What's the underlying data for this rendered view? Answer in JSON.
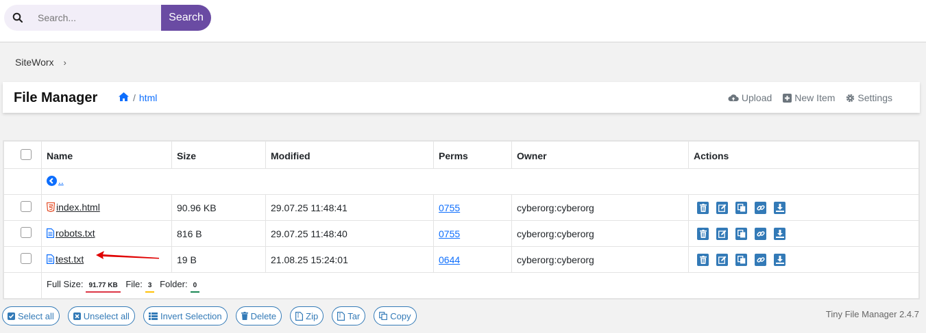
{
  "search": {
    "placeholder": "Search...",
    "button_label": "Search"
  },
  "breadcrumb": {
    "label": "SiteWorx"
  },
  "header": {
    "title": "File Manager",
    "path": "html",
    "actions": {
      "upload": "Upload",
      "new_item": "New Item",
      "settings": "Settings"
    }
  },
  "table": {
    "columns": [
      "Name",
      "Size",
      "Modified",
      "Perms",
      "Owner",
      "Actions"
    ],
    "parent_link": "..",
    "rows": [
      {
        "name": "index.html",
        "size": "90.96 KB",
        "modified": "29.07.25 11:48:41",
        "perms": "0755",
        "owner": "cyberorg:cyberorg",
        "icon": "html5-icon"
      },
      {
        "name": "robots.txt",
        "size": "816 B",
        "modified": "29.07.25 11:48:40",
        "perms": "0755",
        "owner": "cyberorg:cyberorg",
        "icon": "text-file-icon"
      },
      {
        "name": "test.txt",
        "size": "19 B",
        "modified": "21.08.25 15:24:01",
        "perms": "0644",
        "owner": "cyberorg:cyberorg",
        "icon": "text-file-icon"
      }
    ],
    "footer": {
      "full_size_label": "Full Size:",
      "full_size": "91.77 KB",
      "file_label": "File:",
      "file_count": "3",
      "folder_label": "Folder:",
      "folder_count": "0"
    }
  },
  "bottom_actions": [
    "Select all",
    "Unselect all",
    "Invert Selection",
    "Delete",
    "Zip",
    "Tar",
    "Copy"
  ],
  "version": "Tiny File Manager 2.4.7",
  "colors": {
    "accent": "#6a4ba3",
    "link": "#0d6efd",
    "action_icon": "#337ab7",
    "arrow": "#e00000"
  }
}
